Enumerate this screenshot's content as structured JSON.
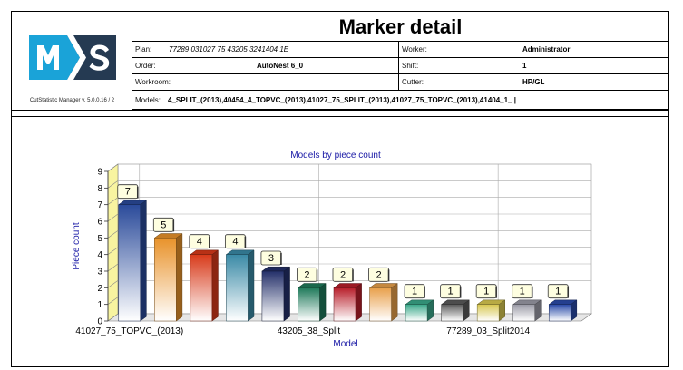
{
  "header": {
    "title": "Marker detail",
    "version": "CutStatistic Manager v. 5.0.0.16 / 2",
    "plan_label": "Plan:",
    "plan_value": "77289 031027 75 43205 3241404 1E",
    "worker_label": "Worker:",
    "worker_value": "Administrator",
    "order_label": "Order:",
    "order_value": "AutoNest 6_0",
    "shift_label": "Shift:",
    "shift_value": "1",
    "workroom_label": "Workroom:",
    "workroom_value": "",
    "cutter_label": "Cutter:",
    "cutter_value": "HP/GL",
    "models_label": "Models:",
    "models_value": "4_SPLIT_(2013),40454_4_TOPVC_(2013),41027_75_SPLIT_(2013),41027_75_TOPVC_(2013),41404_1_  |"
  },
  "chart_data": {
    "type": "bar",
    "title": "Models by piece count",
    "xlabel": "Model",
    "ylabel": "Piece count",
    "ylim": [
      0,
      9
    ],
    "yticks": [
      0,
      1,
      2,
      3,
      4,
      5,
      6,
      7,
      8,
      9
    ],
    "grid": true,
    "values": [
      7,
      5,
      4,
      4,
      3,
      2,
      2,
      2,
      1,
      1,
      1,
      1,
      1
    ],
    "x_tick_labels": [
      {
        "index": 0,
        "label": "41027_75_TOPVC_(2013)"
      },
      {
        "index": 5,
        "label": "43205_38_Split"
      },
      {
        "index": 10,
        "label": "77289_03_Split2014"
      }
    ],
    "colors": [
      "#2a4a9a",
      "#e8922a",
      "#d83a1a",
      "#3a8aa6",
      "#24306a",
      "#1f7a5a",
      "#b81e2a",
      "#e8a04a",
      "#3aa88a",
      "#5a5a5a",
      "#d8c850",
      "#9a9aa6",
      "#2a4aa8"
    ]
  }
}
